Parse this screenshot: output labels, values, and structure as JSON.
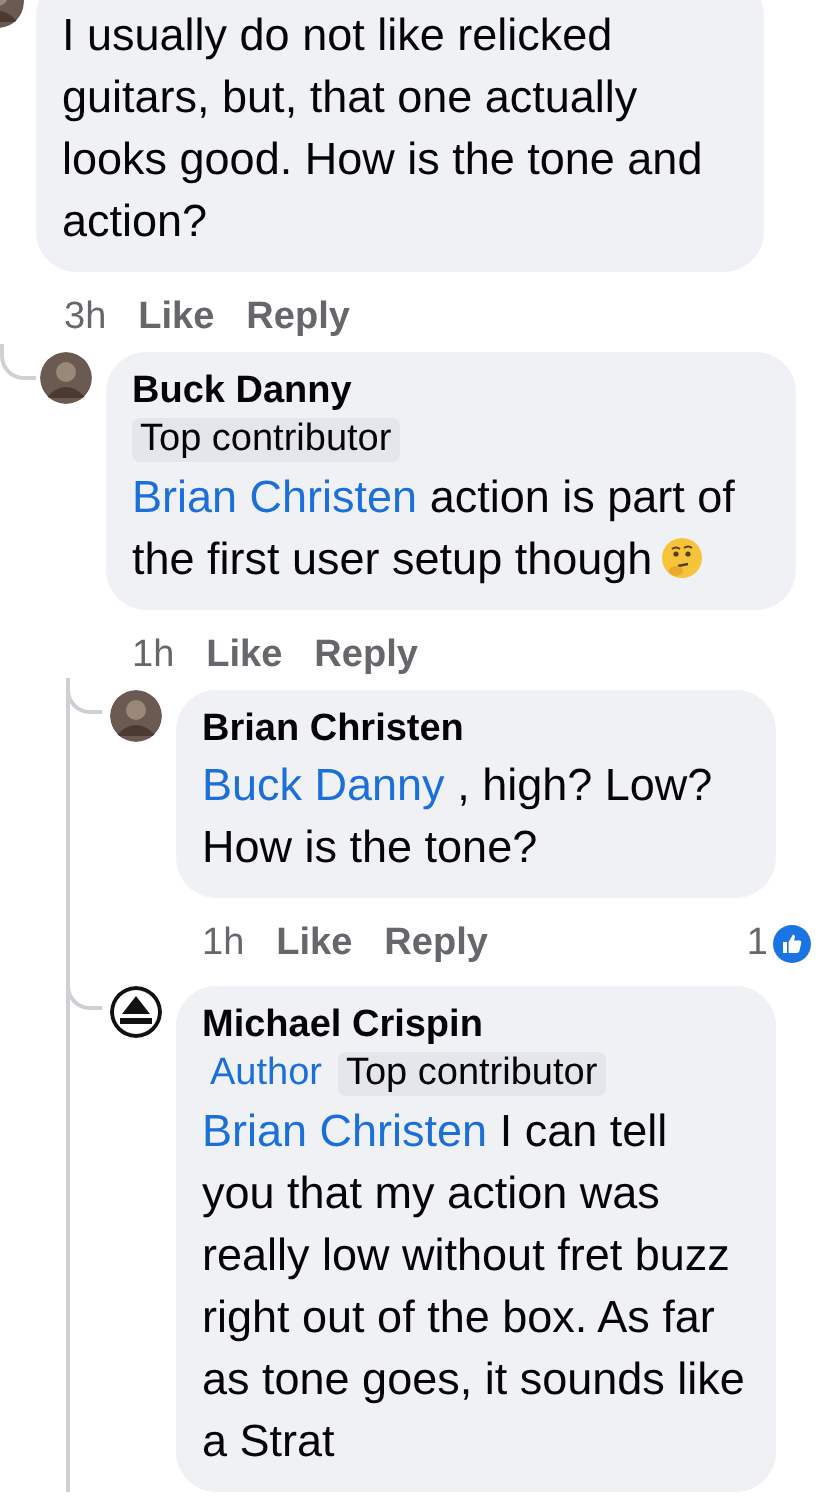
{
  "comments": [
    {
      "avatar": {
        "kind": "photo"
      },
      "text": "I usually do not like relicked guitars, but, that one actually looks good. How is the tone and action?",
      "time": "3h",
      "like": "Like",
      "reply": "Reply",
      "children": [
        {
          "avatar": {
            "kind": "photo"
          },
          "author": "Buck Danny",
          "badges": [
            {
              "label": "Top contributor",
              "kind": "contributor"
            }
          ],
          "mention": "Brian Christen",
          "text": "action is part of the first user setup though",
          "emoji": true,
          "time": "1h",
          "like": "Like",
          "reply": "Reply",
          "children": [
            {
              "avatar": {
                "kind": "photo"
              },
              "author": "Brian Christen",
              "mention": "Buck Danny",
              "text": ", high? Low? How is the tone?",
              "time": "1h",
              "like": "Like",
              "reply": "Reply",
              "reaction_count": "1"
            },
            {
              "avatar": {
                "kind": "logo"
              },
              "author": "Michael Crispin",
              "badges": [
                {
                  "label": "Author",
                  "kind": "author"
                },
                {
                  "label": "Top contributor",
                  "kind": "contributor"
                }
              ],
              "mention": "Brian Christen",
              "text": "I can tell you that my action was really low without fret buzz right out of the box. As far as tone goes, it sounds like a Strat"
            }
          ]
        }
      ]
    }
  ]
}
